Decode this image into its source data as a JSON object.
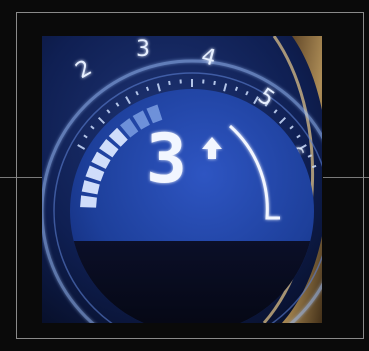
{
  "gauge": {
    "scale_numbers": [
      "2",
      "3",
      "4",
      "5",
      "6"
    ],
    "current_gear": "3",
    "shift_indicator_icon": "up-arrow-icon"
  },
  "colors": {
    "lcd_blue": "#1d3f9a",
    "digit_white": "#f2f6ff",
    "ring_glow": "#9fc2ff",
    "brass_trim": "#c9a15a"
  }
}
